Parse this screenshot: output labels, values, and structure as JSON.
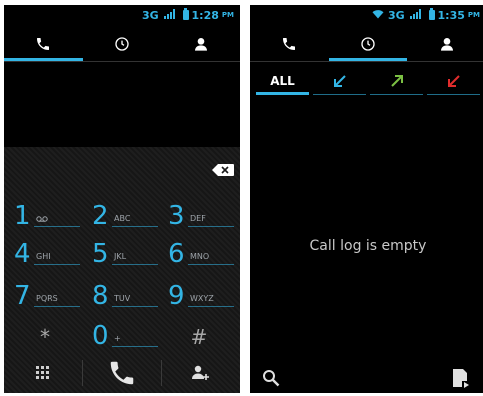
{
  "left": {
    "status": {
      "network": "3G",
      "time": "1:28",
      "ampm": "PM"
    },
    "tabs": [
      {
        "icon": "phone-icon",
        "selected": true
      },
      {
        "icon": "clock-icon",
        "selected": false
      },
      {
        "icon": "contact-icon",
        "selected": false
      }
    ],
    "keys": [
      {
        "digit": "1",
        "letters": ""
      },
      {
        "digit": "2",
        "letters": "ABC"
      },
      {
        "digit": "3",
        "letters": "DEF"
      },
      {
        "digit": "4",
        "letters": "GHI"
      },
      {
        "digit": "5",
        "letters": "JKL"
      },
      {
        "digit": "6",
        "letters": "MNO"
      },
      {
        "digit": "7",
        "letters": "PQRS"
      },
      {
        "digit": "8",
        "letters": "TUV"
      },
      {
        "digit": "9",
        "letters": "WXYZ"
      },
      {
        "digit": "0",
        "letters": "+"
      }
    ],
    "star": "*",
    "hash": "#"
  },
  "right": {
    "status": {
      "network": "3G",
      "time": "1:35",
      "ampm": "PM"
    },
    "filter_all_label": "ALL",
    "empty_message": "Call log is empty"
  },
  "colors": {
    "accent": "#33b5e5",
    "missed": "#e02c2c",
    "outgoing": "#7bc043",
    "incoming": "#33b5e5"
  }
}
